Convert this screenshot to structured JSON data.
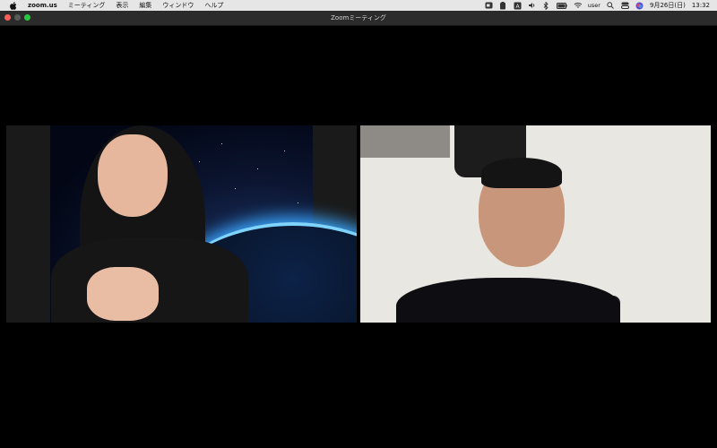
{
  "menubar": {
    "app_name": "zoom.us",
    "menus": [
      "ミーティング",
      "表示",
      "編集",
      "ウィンドウ",
      "ヘルプ"
    ],
    "status": {
      "user": "user",
      "date": "9月26日(日)",
      "time": "13:32"
    },
    "icons": [
      "apple-icon",
      "zoom-status-icon",
      "clipboard-icon",
      "input-method-icon",
      "volume-icon",
      "bluetooth-icon",
      "battery-icon",
      "wifi-icon",
      "search-icon",
      "control-center-icon",
      "siri-icon"
    ]
  },
  "window": {
    "title": "Zoomミーティング"
  },
  "colors": {
    "menubar_bg": "#e6e6e6",
    "titlebar_bg": "#2b2b2b",
    "close": "#ff5f57",
    "minimize_disabled": "#5a5a5a",
    "zoom": "#28c840",
    "stage_bg": "#000000"
  }
}
